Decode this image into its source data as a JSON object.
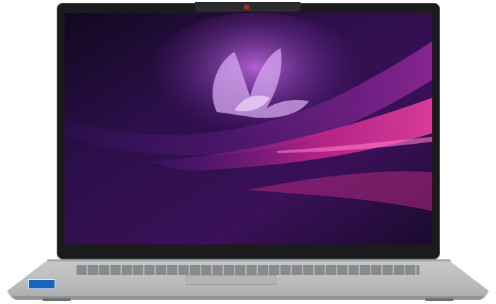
{
  "image": {
    "subject": "laptop-front-view",
    "colors": {
      "bezel": "#1b1b1e",
      "chassis": "#c0c2c3",
      "wallpaper_dark": "#1a0a2e",
      "wallpaper_purple": "#6a1f9a",
      "wallpaper_magenta": "#c8258e",
      "webcam_light": "#c3242b",
      "sticker_blue": "#1565c0"
    },
    "sticker_text": ""
  }
}
